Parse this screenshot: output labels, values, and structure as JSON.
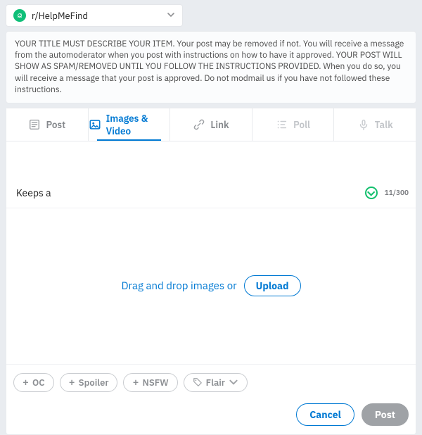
{
  "community": {
    "name": "r/HelpMeFind"
  },
  "rules_text": "YOUR TITLE MUST DESCRIBE YOUR ITEM. Your post may be removed if not. You will receive a message from the automoderator when you post with instructions on how to have it approved. YOUR POST WILL SHOW AS SPAM/REMOVED UNTIL YOU FOLLOW THE INSTRUCTIONS PROVIDED. When you do so, you will receive a message that your post is approved. Do not modmail us if you have not followed these instructions.",
  "tabs": {
    "post": "Post",
    "images": "Images & Video",
    "link": "Link",
    "poll": "Poll",
    "talk": "Talk"
  },
  "title": {
    "value": "Keeps a",
    "counter": "11/300"
  },
  "dropzone": {
    "text": "Drag and drop images or",
    "upload": "Upload"
  },
  "tags": {
    "oc": "OC",
    "spoiler": "Spoiler",
    "nsfw": "NSFW",
    "flair": "Flair"
  },
  "actions": {
    "cancel": "Cancel",
    "post": "Post"
  }
}
